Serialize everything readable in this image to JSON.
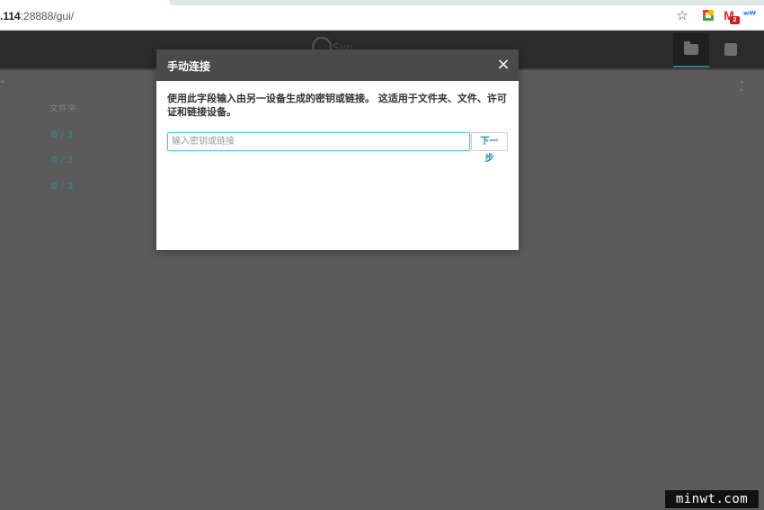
{
  "browser": {
    "url_host": ".114",
    "url_rest": ":28888/gui/",
    "extensions": {
      "mail_badge": "2",
      "star_icon": "star-outline-icon",
      "ext1_icon": "colorful-square-extension-icon",
      "ext2_icon": "gmail-icon",
      "ext3_icon": "wave-extension-icon"
    }
  },
  "navbar": {
    "logo_text": "Syn",
    "folder_icon": "folder-icon",
    "device_icon": "device-add-icon"
  },
  "background": {
    "side_arrow": "◂",
    "nav_arrows": "◂ ▸",
    "heading": "文件夹",
    "rows": [
      "0 / 3",
      "0 / 3",
      "0 / 3"
    ]
  },
  "modal": {
    "title": "手动连接",
    "close_label": "×",
    "description": "使用此字段输入由另一设备生成的密钥或链接。 这适用于文件夹、文件、许可证和链接设备。",
    "input_placeholder": "输入密钥或链接",
    "input_value": "",
    "next_button": "下一步"
  },
  "watermark": "minwt.com",
  "colors": {
    "overlay": "#5b5b5b",
    "modal_header": "#4a4a4a",
    "accent": "#5bc0de",
    "link_text": "#1f8fa5"
  }
}
